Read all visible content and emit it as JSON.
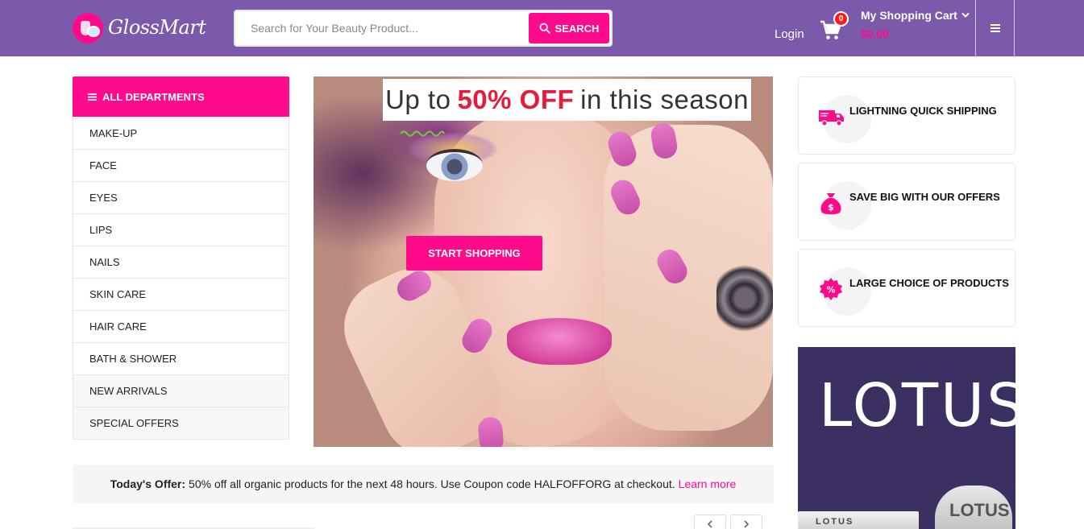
{
  "header": {
    "logo_text": "GlossMart",
    "search": {
      "placeholder": "Search for Your Beauty Product...",
      "button_label": "SEARCH"
    },
    "login_label": "Login",
    "cart": {
      "count": "0",
      "title": "My Shopping Cart",
      "total": "$0.00"
    }
  },
  "sidebar": {
    "title": "ALL DEPARTMENTS",
    "items": [
      {
        "label": "MAKE-UP"
      },
      {
        "label": "FACE"
      },
      {
        "label": "EYES"
      },
      {
        "label": "LIPS"
      },
      {
        "label": "NAILS"
      },
      {
        "label": "SKIN CARE"
      },
      {
        "label": "HAIR CARE"
      },
      {
        "label": "BATH & SHOWER"
      },
      {
        "label": "NEW ARRIVALS"
      },
      {
        "label": "SPECIAL OFFERS"
      }
    ]
  },
  "hero": {
    "banner_pre": "Up to",
    "banner_highlight": "50% OFF",
    "banner_post": "in this season",
    "cta_label": "START SHOPPING"
  },
  "features": [
    {
      "label": "LIGHTNING QUICK SHIPPING",
      "icon": "delivery-truck-icon"
    },
    {
      "label": "SAVE BIG WITH OUR OFFERS",
      "icon": "money-bag-icon"
    },
    {
      "label": "LARGE CHOICE OF PRODUCTS",
      "icon": "percent-badge-icon"
    }
  ],
  "ad": {
    "brand": "LOTUS",
    "product_label_1": "LOTUS",
    "product_label_2": "LOTUS"
  },
  "offer": {
    "prefix": "Today's Offer:",
    "text": "50% off all organic products for the next 48 hours. Use Coupon code HALFOFFORG at checkout.",
    "link": "Learn more"
  },
  "colors": {
    "header_bg": "#7b5aab",
    "accent": "#ff0a8b",
    "ad_bg": "#3b3061",
    "offer_highlight": "#e8193a"
  }
}
